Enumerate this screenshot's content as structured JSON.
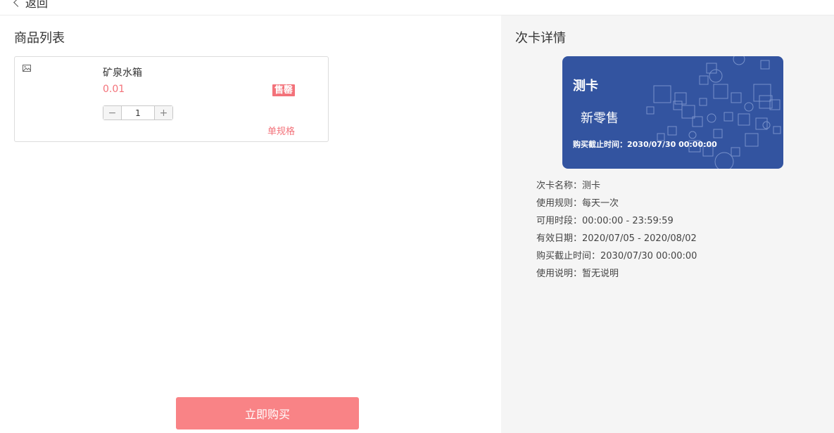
{
  "header": {
    "back_label": "返回"
  },
  "products": {
    "title": "商品列表",
    "item": {
      "name": "矿泉水箱",
      "price": "0.01",
      "badge": "售罄",
      "quantity": "1",
      "spec_label": "单规格"
    },
    "buy_label": "立即购买"
  },
  "card_detail": {
    "title": "次卡详情",
    "card": {
      "name": "测卡",
      "brand": "新零售",
      "deadline": "购买截止时间：2030/07/30 00:00:00",
      "color": "#3354a0"
    },
    "rows": [
      "次卡名称：测卡",
      "使用规则：每天一次",
      "可用时段：00:00:00 - 23:59:59",
      "有效日期：2020/07/05 - 2020/08/02",
      "购买截止时间：2030/07/30 00:00:00",
      "使用说明：暂无说明"
    ]
  },
  "colors": {
    "accent": "#f3727a",
    "buy_button": "#f98386",
    "panel_bg": "#f5f5f5"
  },
  "icons": {
    "back": "chevron-left-icon",
    "image": "image-placeholder-icon",
    "minus": "minus-icon",
    "plus": "plus-icon"
  }
}
